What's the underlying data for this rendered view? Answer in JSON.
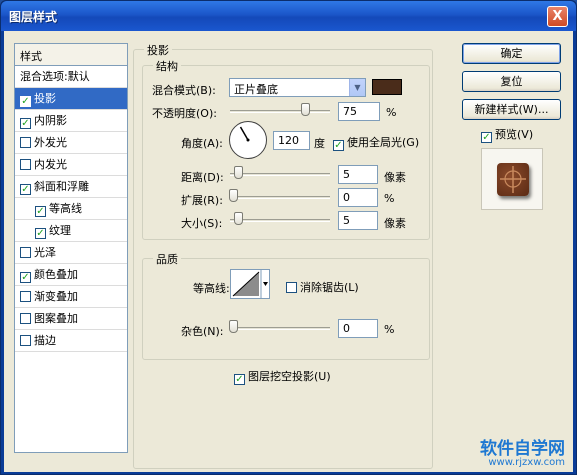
{
  "window": {
    "title": "图层样式",
    "close_glyph": "X"
  },
  "style_list": {
    "header": "样式",
    "blend_options": "混合选项:默认",
    "items": [
      {
        "label": "投影",
        "checked": true,
        "indent": false,
        "selected": true
      },
      {
        "label": "内阴影",
        "checked": true,
        "indent": false,
        "selected": false
      },
      {
        "label": "外发光",
        "checked": false,
        "indent": false,
        "selected": false
      },
      {
        "label": "内发光",
        "checked": false,
        "indent": false,
        "selected": false
      },
      {
        "label": "斜面和浮雕",
        "checked": true,
        "indent": false,
        "selected": false
      },
      {
        "label": "等高线",
        "checked": true,
        "indent": true,
        "selected": false
      },
      {
        "label": "纹理",
        "checked": true,
        "indent": true,
        "selected": false
      },
      {
        "label": "光泽",
        "checked": false,
        "indent": false,
        "selected": false
      },
      {
        "label": "颜色叠加",
        "checked": true,
        "indent": false,
        "selected": false
      },
      {
        "label": "渐变叠加",
        "checked": false,
        "indent": false,
        "selected": false
      },
      {
        "label": "图案叠加",
        "checked": false,
        "indent": false,
        "selected": false
      },
      {
        "label": "描边",
        "checked": false,
        "indent": false,
        "selected": false
      }
    ]
  },
  "drop_shadow": {
    "section_title": "投影",
    "structure": {
      "title": "结构",
      "blend_mode_label": "混合模式(B):",
      "blend_mode_value": "正片叠底",
      "shadow_color": "#4a2c1a",
      "opacity_label": "不透明度(O):",
      "opacity_value": "75",
      "opacity_unit": "%",
      "opacity_fraction": 0.75,
      "angle_label": "角度(A):",
      "angle_value": "120",
      "angle_unit": "度",
      "global_light_label": "使用全局光(G)",
      "global_light_checked": true,
      "distance_label": "距离(D):",
      "distance_value": "5",
      "distance_unit": "像素",
      "spread_label": "扩展(R):",
      "spread_value": "0",
      "spread_unit": "%",
      "size_label": "大小(S):",
      "size_value": "5",
      "size_unit": "像素"
    },
    "quality": {
      "title": "品质",
      "contour_label": "等高线:",
      "anti_alias_label": "消除锯齿(L)",
      "anti_alias_checked": false,
      "noise_label": "杂色(N):",
      "noise_value": "0",
      "noise_unit": "%"
    },
    "knockout_label": "图层挖空投影(U)",
    "knockout_checked": true
  },
  "buttons": {
    "ok": "确定",
    "reset": "复位",
    "new_style": "新建样式(W)...",
    "preview_label": "预览(V)",
    "preview_checked": true
  },
  "watermark": {
    "brand": "软件自学网",
    "url": "www.rjzxw.com"
  }
}
